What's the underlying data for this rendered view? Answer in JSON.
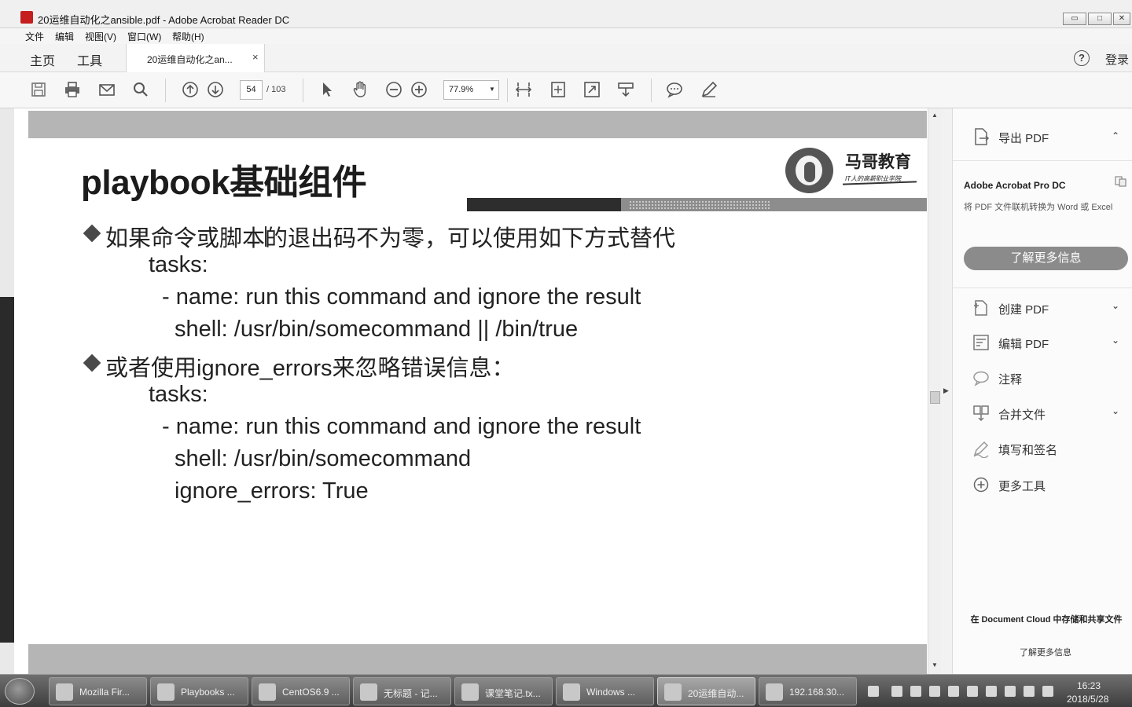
{
  "window": {
    "title": "20运维自动化之ansible.pdf - Adobe Acrobat Reader DC",
    "min_label": "▭",
    "max_label": "□",
    "close_label": "✕"
  },
  "menu": [
    "文件",
    "编辑",
    "视图(V)",
    "窗口(W)",
    "帮助(H)"
  ],
  "tabs": {
    "home": "主页",
    "tools": "工具",
    "doc": "20运维自动化之an...",
    "close": "×",
    "help": "?",
    "login": "登录"
  },
  "toolbar": {
    "page_current": "54",
    "page_total": "/ 103",
    "zoom": "77.9%",
    "zoom_arrow": "▼",
    "icons": [
      "save-icon",
      "print-icon",
      "email-icon",
      "search-icon",
      "page-up-icon",
      "page-down-icon",
      "select-icon",
      "hand-icon",
      "zoom-out-icon",
      "zoom-in-icon",
      "fit-width-icon",
      "fit-page-icon",
      "full-screen-icon",
      "scroll-mode-icon",
      "comment-icon",
      "sign-icon"
    ]
  },
  "slide": {
    "title": "playbook基础组件",
    "logo_name": "马哥教育",
    "logo_slogan": "IT人的高薪职业学院",
    "lines": [
      "如果命令或脚本的退出码不为零，可以使用如下方式替代",
      "tasks:",
      "- name: run this command and ignore the result",
      "shell: /usr/bin/somecommand || /bin/true",
      "或者使用ignore_errors来忽略错误信息：",
      "tasks:",
      "- name: run this command and ignore the result",
      "shell: /usr/bin/somecommand",
      "ignore_errors: True"
    ]
  },
  "scroll": {
    "up": "▲",
    "down": "▼",
    "toggle": "▶"
  },
  "right_panel": {
    "export_pdf": "导出 PDF",
    "product": "Adobe Acrobat Pro DC",
    "desc": "将 PDF 文件联机转换为 Word 或 Excel",
    "learn_more_btn": "了解更多信息",
    "tools": [
      {
        "label": "创建 PDF",
        "chev": "⌄"
      },
      {
        "label": "编辑 PDF",
        "chev": "⌄"
      },
      {
        "label": "注释",
        "chev": ""
      },
      {
        "label": "合并文件",
        "chev": "⌄"
      },
      {
        "label": "填写和签名",
        "chev": ""
      },
      {
        "label": "更多工具",
        "chev": ""
      }
    ],
    "collapse": "⌃",
    "cloud_text": "在 Document Cloud 中存储和共享文件",
    "cloud_link": "了解更多信息"
  },
  "taskbar": {
    "tasks": [
      "Mozilla Fir...",
      "Playbooks ...",
      "CentOS6.9 ...",
      "无标题 - 记...",
      "课堂笔记.tx...",
      "Windows ...",
      "20运维自动...",
      "192.168.30..."
    ],
    "time": "16:23",
    "date": "2018/5/28"
  }
}
